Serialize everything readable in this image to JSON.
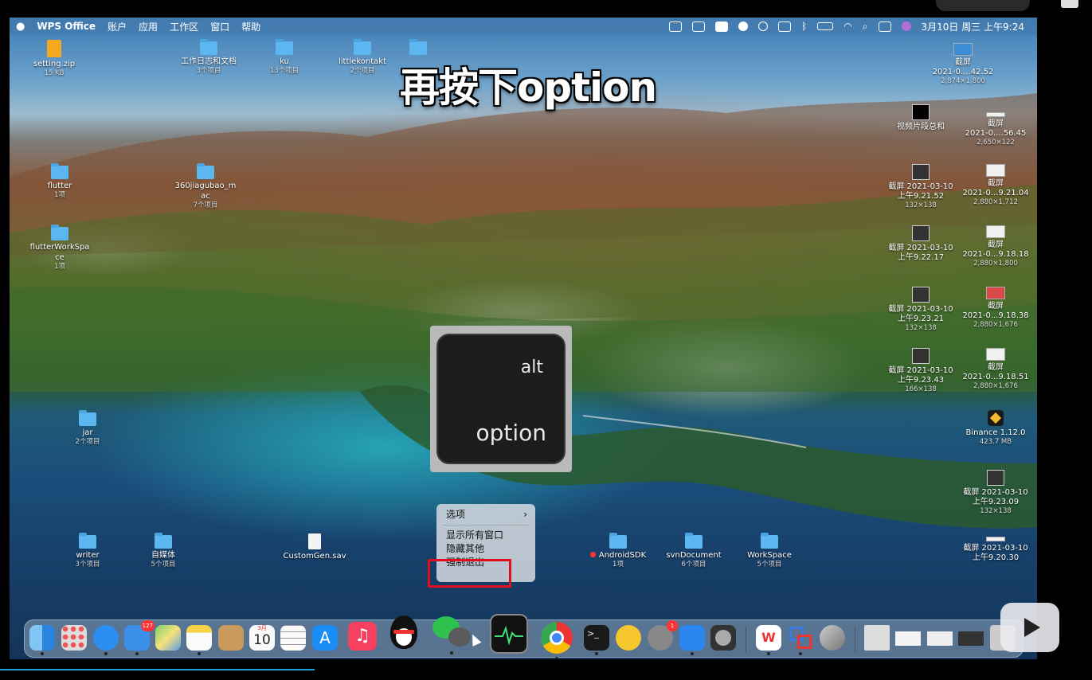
{
  "menubar": {
    "apple": "",
    "app": "WPS Office",
    "menus": [
      "账户",
      "应用",
      "工作区",
      "窗口",
      "帮助"
    ],
    "datetime": "3月10日 周三 上午9:24"
  },
  "caption": "再按下option",
  "key": {
    "top": "alt",
    "bottom": "option"
  },
  "desktop_left": [
    {
      "name": "setting.zip",
      "sub": "15 KB"
    },
    {
      "name": "工作日志和文档",
      "sub": "3个项目"
    },
    {
      "name": "ku",
      "sub": "13个项目"
    },
    {
      "name": "littlekontakt",
      "sub": "2个项目"
    },
    {
      "name": "flutter",
      "sub": "1项"
    },
    {
      "name": "360jiagubao_m",
      "name2": "ac",
      "sub": "7个项目"
    },
    {
      "name": "flutterWorkSpa",
      "name2": "ce",
      "sub": "1项"
    },
    {
      "name": "jar",
      "sub": "2个项目"
    },
    {
      "name": "writer",
      "sub": "3个项目"
    },
    {
      "name": "自媒体",
      "sub": "5个项目"
    },
    {
      "name": "CustomGen.sav",
      "sub": ""
    },
    {
      "name": "AndroidSDK",
      "sub": "1项"
    },
    {
      "name": "svnDocument",
      "sub": "6个项目"
    },
    {
      "name": "WorkSpace",
      "sub": "5个项目"
    }
  ],
  "desktop_right": [
    {
      "name": "截屏",
      "name2": "2021-0....42.52",
      "sub": "2,874×1,800"
    },
    {
      "name": "视频片段总和",
      "sub": ""
    },
    {
      "name": "截屏",
      "name2": "2021-0....56.45",
      "sub": "2,650×122"
    },
    {
      "name": "截屏 2021-03-10",
      "name2": "上午9.21.52",
      "sub": "132×138"
    },
    {
      "name": "截屏",
      "name2": "2021-0...9.21.04",
      "sub": "2,880×1,712"
    },
    {
      "name": "截屏 2021-03-10",
      "name2": "上午9.22.17",
      "sub": ""
    },
    {
      "name": "截屏",
      "name2": "2021-0...9.18.18",
      "sub": "2,880×1,800"
    },
    {
      "name": "截屏 2021-03-10",
      "name2": "上午9.23.21",
      "sub": "132×138"
    },
    {
      "name": "截屏",
      "name2": "2021-0...9.18.38",
      "sub": "2,880×1,676"
    },
    {
      "name": "截屏 2021-03-10",
      "name2": "上午9.23.43",
      "sub": "166×138"
    },
    {
      "name": "截屏",
      "name2": "2021-0...9.18.51",
      "sub": "2,880×1,676"
    },
    {
      "name": "Binance 1.12.0",
      "sub": "423.7 MB"
    },
    {
      "name": "截屏 2021-03-10",
      "name2": "上午9.23.09",
      "sub": "132×138"
    },
    {
      "name": "截屏 2021-03-10",
      "name2": "上午9.20.30",
      "sub": ""
    }
  ],
  "context_menu": {
    "options": "选项",
    "show_all": "显示所有窗口",
    "hide_others": "隐藏其他",
    "force_quit": "强制退出"
  },
  "dock": {
    "mail_badge": "127",
    "calendar_month": "3月",
    "calendar_day": "10",
    "prefs_badge": "1"
  },
  "colors": {
    "highlight": "#e20c1f",
    "folder": "#5cb6ef"
  }
}
